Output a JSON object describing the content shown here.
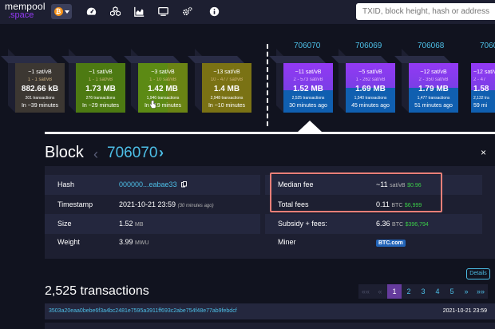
{
  "header": {
    "logo_top": "mempool",
    "logo_bottom": ".space",
    "network_icon": "bitcoin-icon",
    "network_symbol": "₿",
    "nav_icons": [
      "dashboard-icon",
      "cubes-icon",
      "chart-icon",
      "tv-icon",
      "cogs-icon",
      "info-icon"
    ],
    "search_placeholder": "TXID, block height, hash or address"
  },
  "mempool_blocks": [
    {
      "fee": "~1 sat/vB",
      "range": "1 - 1 sat/vB",
      "size": "882.66 kB",
      "txs": "201 transactions",
      "time": "In ~39 minutes",
      "color": "#3c3732"
    },
    {
      "fee": "~1 sat/vB",
      "range": "1 - 1 sat/vB",
      "size": "1.73 MB",
      "txs": "276 transactions",
      "time": "In ~29 minutes",
      "color": "#4d7a12"
    },
    {
      "fee": "~3 sat/vB",
      "range": "1 - 10 sat/vB",
      "size": "1.42 MB",
      "txs": "1,946 transactions",
      "time": "In ~19 minutes",
      "color": "#5c8a14"
    },
    {
      "fee": "~13 sat/vB",
      "range": "10 - 477 sat/vB",
      "size": "1.4 MB",
      "txs": "2,948 transactions",
      "time": "In ~10 minutes",
      "color": "#7a7214"
    }
  ],
  "mined_blocks": [
    {
      "height": "706070",
      "fee": "~11 sat/vB",
      "range": "2 - 573 sat/vB",
      "size": "1.52 MB",
      "txs": "2,525 transactions",
      "time": "30 minutes ago"
    },
    {
      "height": "706069",
      "fee": "~5 sat/vB",
      "range": "1 - 262 sat/vB",
      "size": "1.69 MB",
      "txs": "1,540 transactions",
      "time": "45 minutes ago"
    },
    {
      "height": "706068",
      "fee": "~12 sat/vB",
      "range": "2 - 350 sat/vB",
      "size": "1.79 MB",
      "txs": "1,477 transactions",
      "time": "51 minutes ago"
    },
    {
      "height": "70606",
      "fee": "~12 sat/vB",
      "range": "2 - 47",
      "size": "1.58",
      "txs": "2,132 tra",
      "time": "59 mi"
    }
  ],
  "block": {
    "title": "Block",
    "prev_symbol": "‹",
    "height": "706070",
    "next_symbol": "›",
    "close_symbol": "×",
    "hash_label": "Hash",
    "hash_value": "000000...eabae33",
    "timestamp_label": "Timestamp",
    "timestamp_value": "2021-10-21 23:59",
    "timestamp_relative": "(30 minutes ago)",
    "size_label": "Size",
    "size_value": "1.52",
    "size_unit": "MB",
    "weight_label": "Weight",
    "weight_value": "3.99",
    "weight_unit": "MWU",
    "median_fee_label": "Median fee",
    "median_fee_value": "~11",
    "median_fee_unit": "sat/vB",
    "median_fee_usd": "$0.96",
    "total_fees_label": "Total fees",
    "total_fees_value": "0.11",
    "total_fees_unit": "BTC",
    "total_fees_usd": "$6,999",
    "subsidy_label": "Subsidy + fees:",
    "subsidy_value": "6.36",
    "subsidy_unit": "BTC",
    "subsidy_usd": "$396,794",
    "miner_label": "Miner",
    "miner_value": "BTC.com",
    "details_button": "Details"
  },
  "transactions": {
    "count_label": "2,525 transactions",
    "pages": [
      "««",
      "«",
      "1",
      "2",
      "3",
      "4",
      "5",
      "»",
      "»»"
    ],
    "active_page": "1",
    "rows": [
      {
        "txid": "3503a20eaa0bebe6f3a4bc2481e7595a3911ff693c2abe754f48e77ab9febdcf",
        "time": "2021-10-21 23:59"
      }
    ]
  },
  "colors": {
    "background": "#11131f",
    "panel": "#1d1f31",
    "accent_blue": "#4dbfe7",
    "mined_block_purple": "#9339f4",
    "mined_block_blue": "#105fb0",
    "highlight_border": "#e87f78"
  }
}
